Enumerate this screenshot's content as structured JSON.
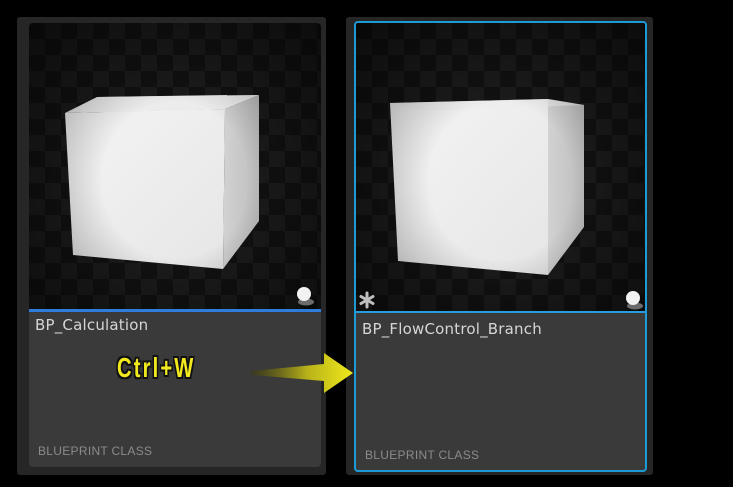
{
  "assets": [
    {
      "name": "BP_Calculation",
      "class_label": "BLUEPRINT CLASS",
      "selected": false,
      "icons": [
        "cube-thumbnail-icon",
        "mobility-icon"
      ]
    },
    {
      "name": "BP_FlowControl_Branch",
      "class_label": "BLUEPRINT CLASS",
      "selected": true,
      "icons": [
        "cube-thumbnail-icon",
        "dirty-asterisk-icon",
        "mobility-icon"
      ]
    }
  ],
  "annotation": {
    "shortcut": "Ctrl+W",
    "arrow_icon": "yellow-arrow-right-icon"
  },
  "colors": {
    "background": "#000000",
    "tile": "#3a3a3a",
    "accent_divider": "#2e7ddc",
    "selection_border": "#1e9bd6",
    "annotation_text": "#f2ea1f"
  }
}
